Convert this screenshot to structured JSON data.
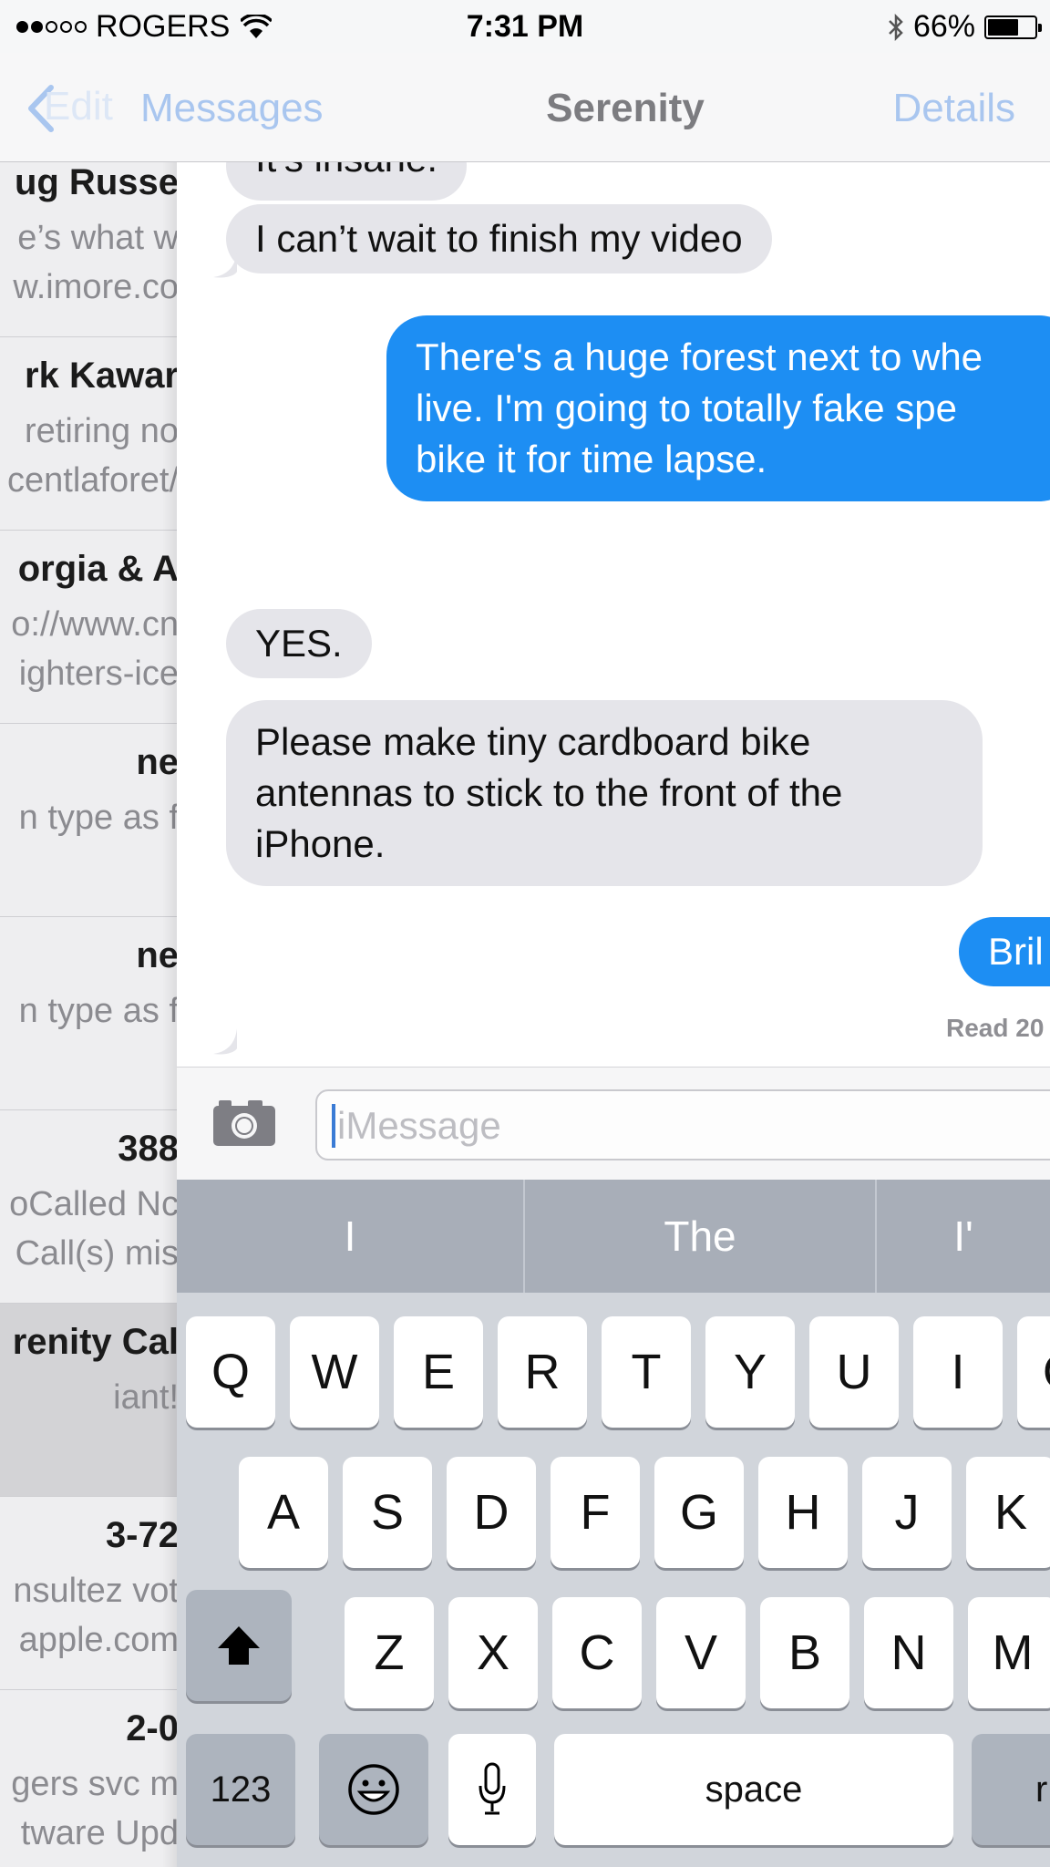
{
  "status_bar": {
    "carrier": "ROGERS",
    "time": "7:31 PM",
    "battery_percent": "66%",
    "battery_level": 0.66
  },
  "nav": {
    "back_label": "Messages",
    "back_ghost": "Edit",
    "title": "Serenity",
    "details_label": "Details"
  },
  "conversations": [
    {
      "name": "ug Russe",
      "line1": "e’s what w",
      "line2": "w.imore.co",
      "active": false
    },
    {
      "name": "rk Kawar",
      "line1": "retiring no",
      "line2": "centlaforet/",
      "active": false
    },
    {
      "name": "orgia & A",
      "line1": "o://www.cn",
      "line2": "ighters-ice",
      "active": false
    },
    {
      "name": "ne",
      "line1": "n type as f",
      "line2": "",
      "active": false
    },
    {
      "name": "ne",
      "line1": "n type as f",
      "line2": "",
      "active": false
    },
    {
      "name": "388",
      "line1": "oCalled Nc",
      "line2": " Call(s) mis",
      "active": false
    },
    {
      "name": "renity Cal",
      "line1": "iant!",
      "line2": "",
      "active": true
    },
    {
      "name": "3-72",
      "line1": "nsultez vot",
      "line2": "apple.com",
      "active": false
    },
    {
      "name": "2-0",
      "line1": "gers svc m",
      "line2": "tware Upd",
      "active": false
    }
  ],
  "messages": {
    "partial_top": "It’s insane.",
    "m1": "I can’t wait to finish my video",
    "m2_lines": [
      "There's a huge forest next to whe",
      "live. I'm going to totally fake spe",
      "bike it for time lapse."
    ],
    "m3": "YES.",
    "m4_lines": [
      "Please make tiny cardboard bike",
      "antennas to stick to the front of the",
      "iPhone."
    ],
    "m5": "Bril",
    "read_receipt": "Read 20"
  },
  "input": {
    "placeholder": "iMessage"
  },
  "predictive": [
    "I",
    "The",
    "I'"
  ],
  "keyboard": {
    "row1": [
      "Q",
      "W",
      "E",
      "R",
      "T",
      "Y",
      "U",
      "I",
      "O"
    ],
    "row2": [
      "A",
      "S",
      "D",
      "F",
      "G",
      "H",
      "J",
      "K"
    ],
    "row3": [
      "Z",
      "X",
      "C",
      "V",
      "B",
      "N",
      "M"
    ],
    "numbers_label": "123",
    "space_label": "space",
    "return_label": "r"
  },
  "colors": {
    "accent": "#1d8ef3",
    "incoming_bubble": "#e5e5ea",
    "nav_link": "#a9c6ef"
  }
}
